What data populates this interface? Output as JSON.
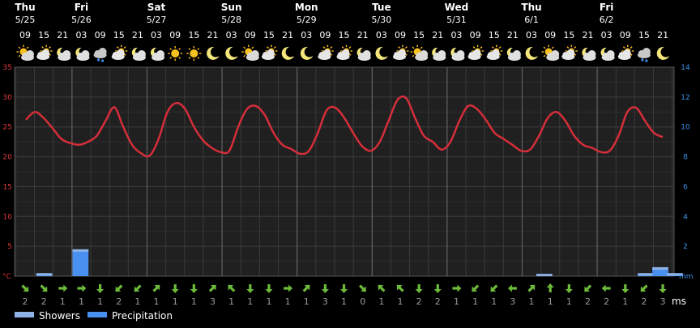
{
  "chart_data": {
    "type": "line",
    "hours_row": [
      "09",
      "15",
      "21",
      "03",
      "09",
      "15",
      "21",
      "03",
      "09",
      "15",
      "21",
      "03",
      "09",
      "15",
      "21",
      "03",
      "09",
      "15",
      "21",
      "03",
      "09",
      "15",
      "21",
      "03",
      "09",
      "15",
      "21",
      "03",
      "09",
      "15",
      "21",
      "03",
      "09",
      "15",
      "21",
      "03",
      "09",
      "15",
      "21"
    ],
    "days": [
      {
        "weekday": "Thu",
        "date": "5/25",
        "col": 0
      },
      {
        "weekday": "Fri",
        "date": "5/26",
        "col": 3
      },
      {
        "weekday": "Sat",
        "date": "5/27",
        "col": 7
      },
      {
        "weekday": "Sun",
        "date": "5/28",
        "col": 11
      },
      {
        "weekday": "Mon",
        "date": "5/29",
        "col": 15
      },
      {
        "weekday": "Tue",
        "date": "5/30",
        "col": 19
      },
      {
        "weekday": "Wed",
        "date": "5/31",
        "col": 23
      },
      {
        "weekday": "Thu",
        "date": "6/1",
        "col": 27
      },
      {
        "weekday": "Fri",
        "date": "6/2",
        "col": 31
      }
    ],
    "icons": [
      "sun-cloud",
      "cloud-sun",
      "cloud-moon",
      "cloud-moon",
      "rain-cloud",
      "cloud-sun",
      "cloud-moon",
      "cloud-moon",
      "sun",
      "sun",
      "moon",
      "moon",
      "sun-cloud",
      "cloud-sun",
      "moon",
      "moon",
      "cloud-sun",
      "cloud-sun",
      "cloud-moon",
      "moon",
      "cloud-sun",
      "sun-cloud",
      "cloud-moon",
      "cloud-moon",
      "cloud-sun",
      "cloud-sun",
      "cloud-moon",
      "moon",
      "sun-cloud",
      "cloud-sun",
      "cloud-moon",
      "cloud-moon",
      "cloud-sun",
      "rain-cloud",
      "moon"
    ],
    "temperature": {
      "name": "temperature",
      "unit": "°C",
      "ylim": [
        0,
        35
      ],
      "ticks": [
        5,
        10,
        15,
        20,
        25,
        30,
        35
      ],
      "values": [
        26.2,
        27.5,
        26.5,
        24.8,
        23.0,
        22.3,
        22.0,
        22.5,
        23.5,
        26.0,
        28.3,
        25.0,
        22.0,
        20.6,
        20.2,
        23.0,
        27.5,
        29.0,
        28.0,
        25.0,
        22.8,
        21.5,
        20.8,
        21.0,
        25.0,
        28.0,
        28.5,
        27.0,
        24.0,
        22.0,
        21.3,
        20.5,
        21.0,
        24.0,
        27.8,
        28.2,
        26.5,
        24.0,
        21.8,
        21.0,
        22.5,
        26.0,
        29.5,
        29.8,
        26.5,
        23.5,
        22.5,
        21.2,
        22.5,
        26.0,
        28.5,
        28.0,
        26.2,
        24.0,
        23.0,
        22.0,
        21.0,
        21.2,
        23.5,
        26.5,
        27.5,
        26.0,
        23.5,
        22.0,
        21.5,
        20.8,
        21.0,
        23.5,
        27.5,
        28.2,
        26.0,
        24.0,
        23.3
      ]
    },
    "precipitation": {
      "unit": "mm",
      "ylim": [
        0,
        14
      ],
      "ticks": [
        2,
        4,
        6,
        8,
        10,
        12,
        14
      ],
      "values": [
        0,
        0,
        0,
        0.2,
        0,
        0,
        0,
        0,
        1.8,
        0,
        0,
        0,
        0,
        0,
        0,
        0,
        0,
        0,
        0,
        0,
        0,
        0,
        0,
        0,
        0,
        0,
        0,
        0,
        0,
        0,
        0,
        0,
        0,
        0,
        0,
        0,
        0,
        0,
        0,
        0,
        0,
        0,
        0,
        0,
        0,
        0,
        0,
        0,
        0,
        0,
        0,
        0,
        0,
        0,
        0,
        0,
        0,
        0,
        0,
        0,
        0,
        0,
        0,
        0,
        0,
        0,
        0,
        0,
        0,
        0,
        0,
        0,
        0.15,
        0,
        0,
        0,
        0,
        0,
        0,
        0,
        0,
        0,
        0,
        0,
        0,
        0,
        0.2,
        0,
        0.6,
        0,
        0.2
      ],
      "colors": {
        "showers": "#8fb3e6",
        "precipitation": "#4a90f0"
      }
    },
    "wind": {
      "unit": "ms",
      "directions": [
        135,
        135,
        90,
        90,
        180,
        225,
        225,
        45,
        180,
        180,
        45,
        315,
        180,
        180,
        90,
        45,
        180,
        180,
        135,
        315,
        315,
        180,
        180,
        90,
        225,
        225,
        270,
        45,
        0,
        180,
        225,
        270,
        180,
        225,
        180
      ],
      "speeds": [
        "2",
        "2",
        "1",
        "1",
        "1",
        "2",
        "1",
        "1",
        "1",
        "1",
        "3",
        "1",
        "1",
        "1",
        "1",
        "1",
        "3",
        "1",
        "0",
        "1",
        "1",
        "2",
        "2",
        "1",
        "1",
        "1",
        "3",
        "1",
        "1",
        "1",
        "2",
        "2",
        "1",
        "2",
        "3",
        "1",
        "1",
        "1",
        "1",
        "2",
        "0"
      ]
    },
    "legend": [
      {
        "label": "Showers",
        "swatch": "#8fb3e6"
      },
      {
        "label": "Precipitation",
        "swatch": "#4a90f0"
      }
    ],
    "colors": {
      "background": "#000000",
      "plot": "#202020",
      "grid": "#3a3a3a",
      "temperature": "#d42e3a",
      "wind_arrow": "#6dbb3a",
      "temp_axis": "#e03a3a",
      "prec_axis": "#3d8fe8"
    }
  }
}
